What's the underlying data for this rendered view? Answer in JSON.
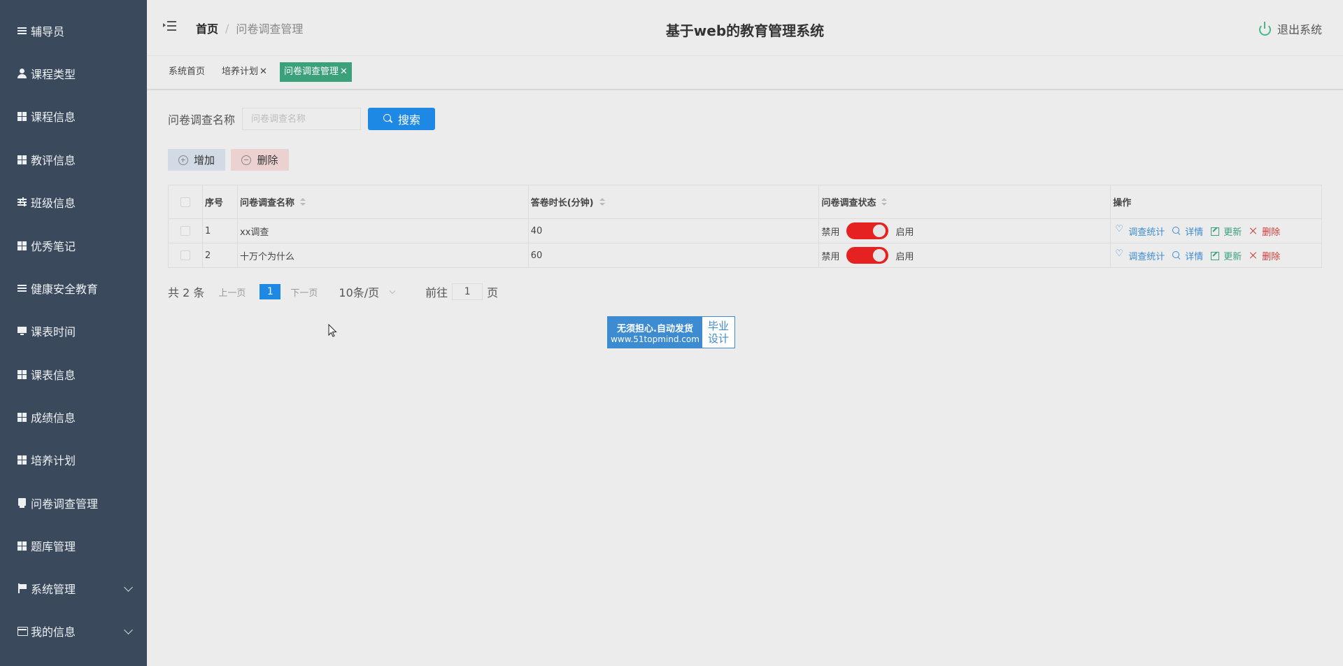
{
  "sidebar": {
    "items": [
      {
        "label": "辅导员",
        "icon": "menu-icon"
      },
      {
        "label": "课程类型",
        "icon": "user-icon"
      },
      {
        "label": "课程信息",
        "icon": "grid-icon"
      },
      {
        "label": "教评信息",
        "icon": "grid-icon"
      },
      {
        "label": "班级信息",
        "icon": "sliders-icon"
      },
      {
        "label": "优秀笔记",
        "icon": "grid-icon"
      },
      {
        "label": "健康安全教育",
        "icon": "list-icon"
      },
      {
        "label": "课表时间",
        "icon": "monitor-icon"
      },
      {
        "label": "课表信息",
        "icon": "grid-icon"
      },
      {
        "label": "成绩信息",
        "icon": "grid-icon"
      },
      {
        "label": "培养计划",
        "icon": "grid-icon"
      },
      {
        "label": "问卷调查管理",
        "icon": "print-icon"
      },
      {
        "label": "题库管理",
        "icon": "grid-icon"
      },
      {
        "label": "系统管理",
        "icon": "flag-icon"
      },
      {
        "label": "我的信息",
        "icon": "card-icon"
      }
    ]
  },
  "header": {
    "breadcrumb_home": "首页",
    "breadcrumb_sep": "/",
    "breadcrumb_current": "问卷调查管理",
    "title": "基于web的教育管理系统",
    "logout": "退出系统"
  },
  "tabs": [
    {
      "label": "系统首页",
      "closable": false
    },
    {
      "label": "培养计划",
      "closable": true
    },
    {
      "label": "问卷调查管理",
      "closable": true,
      "active": true
    }
  ],
  "tab_close": "✕",
  "search": {
    "label": "问卷调查名称",
    "placeholder": "问卷调查名称",
    "button": "搜索"
  },
  "actions": {
    "add": "增加",
    "delete": "删除"
  },
  "table": {
    "headers": {
      "index": "序号",
      "name": "问卷调查名称",
      "duration": "答卷时长(分钟)",
      "status": "问卷调查状态",
      "ops": "操作"
    },
    "rows": [
      {
        "index": "1",
        "name": "xx调查",
        "duration": "40",
        "off": "禁用",
        "on": "启用"
      },
      {
        "index": "2",
        "name": "十万个为什么",
        "duration": "60",
        "off": "禁用",
        "on": "启用"
      }
    ],
    "ops": {
      "stat": "调查统计",
      "detail": "详情",
      "update": "更新",
      "delete": "删除"
    }
  },
  "pager": {
    "total": "共 2 条",
    "prev": "上一页",
    "current": "1",
    "next": "下一页",
    "size": "10条/页",
    "goto": "前往",
    "goto_value": "1",
    "page_unit": "页"
  },
  "stamp": {
    "line1": "无须担心.自动发货",
    "line2": "www.51topmind.com",
    "right1": "毕业",
    "right2": "设计"
  },
  "colors": {
    "sidebar_bg": "#3a4a5c",
    "primary": "#1e88e5",
    "active_tab": "#3aa17b",
    "switch_on": "#e62121"
  }
}
